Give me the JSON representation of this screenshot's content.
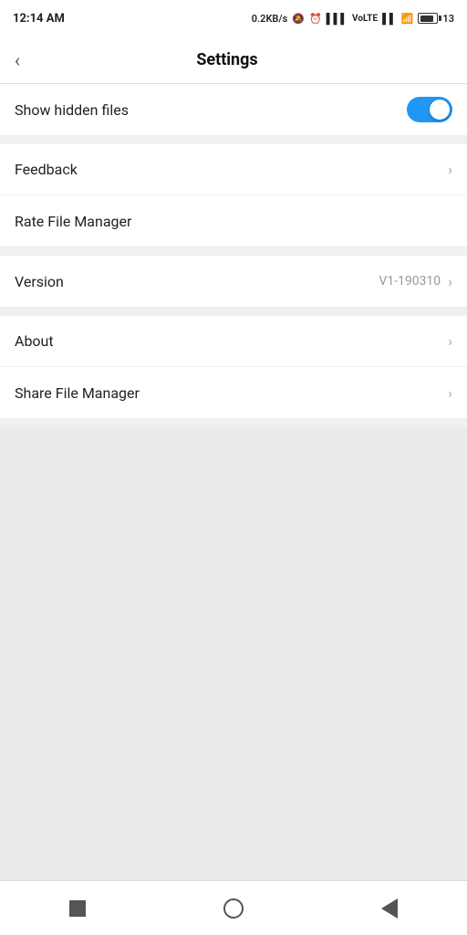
{
  "statusBar": {
    "time": "12:14 AM",
    "network": "0.2KB/s",
    "battery": "13"
  },
  "header": {
    "title": "Settings",
    "backLabel": "‹"
  },
  "sections": [
    {
      "id": "section-1",
      "items": [
        {
          "id": "show-hidden-files",
          "label": "Show hidden files",
          "type": "toggle",
          "toggled": true
        }
      ]
    },
    {
      "id": "section-2",
      "items": [
        {
          "id": "feedback",
          "label": "Feedback",
          "type": "arrow"
        },
        {
          "id": "rate-file-manager",
          "label": "Rate File Manager",
          "type": "none"
        }
      ]
    },
    {
      "id": "section-3",
      "items": [
        {
          "id": "version",
          "label": "Version",
          "type": "arrow",
          "value": "V1-190310"
        }
      ]
    },
    {
      "id": "section-4",
      "items": [
        {
          "id": "about",
          "label": "About",
          "type": "arrow"
        },
        {
          "id": "share-file-manager",
          "label": "Share File Manager",
          "type": "arrow"
        }
      ]
    }
  ],
  "bottomNav": {
    "square": "recent-apps",
    "circle": "home",
    "triangle": "back"
  }
}
